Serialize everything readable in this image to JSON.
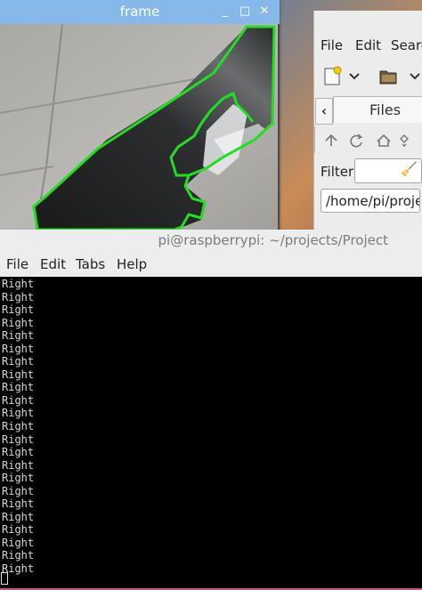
{
  "frame_window": {
    "title": "frame",
    "minimize_glyph": "_",
    "maximize_glyph": "□",
    "close_glyph": "✕",
    "contour_color": "#22dd22"
  },
  "file_manager": {
    "menu": [
      "File",
      "Edit",
      "Searc"
    ],
    "tab_label": "Files",
    "filter_label": "Filter:",
    "path": "/home/pi/proje"
  },
  "terminal": {
    "title": "pi@raspberrypi: ~/projects/Project",
    "menu": [
      "File",
      "Edit",
      "Tabs",
      "Help"
    ],
    "output_lines": [
      "Right",
      "Right",
      "Right",
      "Right",
      "Right",
      "Right",
      "Right",
      "Right",
      "Right",
      "Right",
      "Right",
      "Right",
      "Right",
      "Right",
      "Right",
      "Right",
      "Right",
      "Right",
      "Right",
      "Right",
      "Right",
      "Right",
      "Right"
    ]
  }
}
